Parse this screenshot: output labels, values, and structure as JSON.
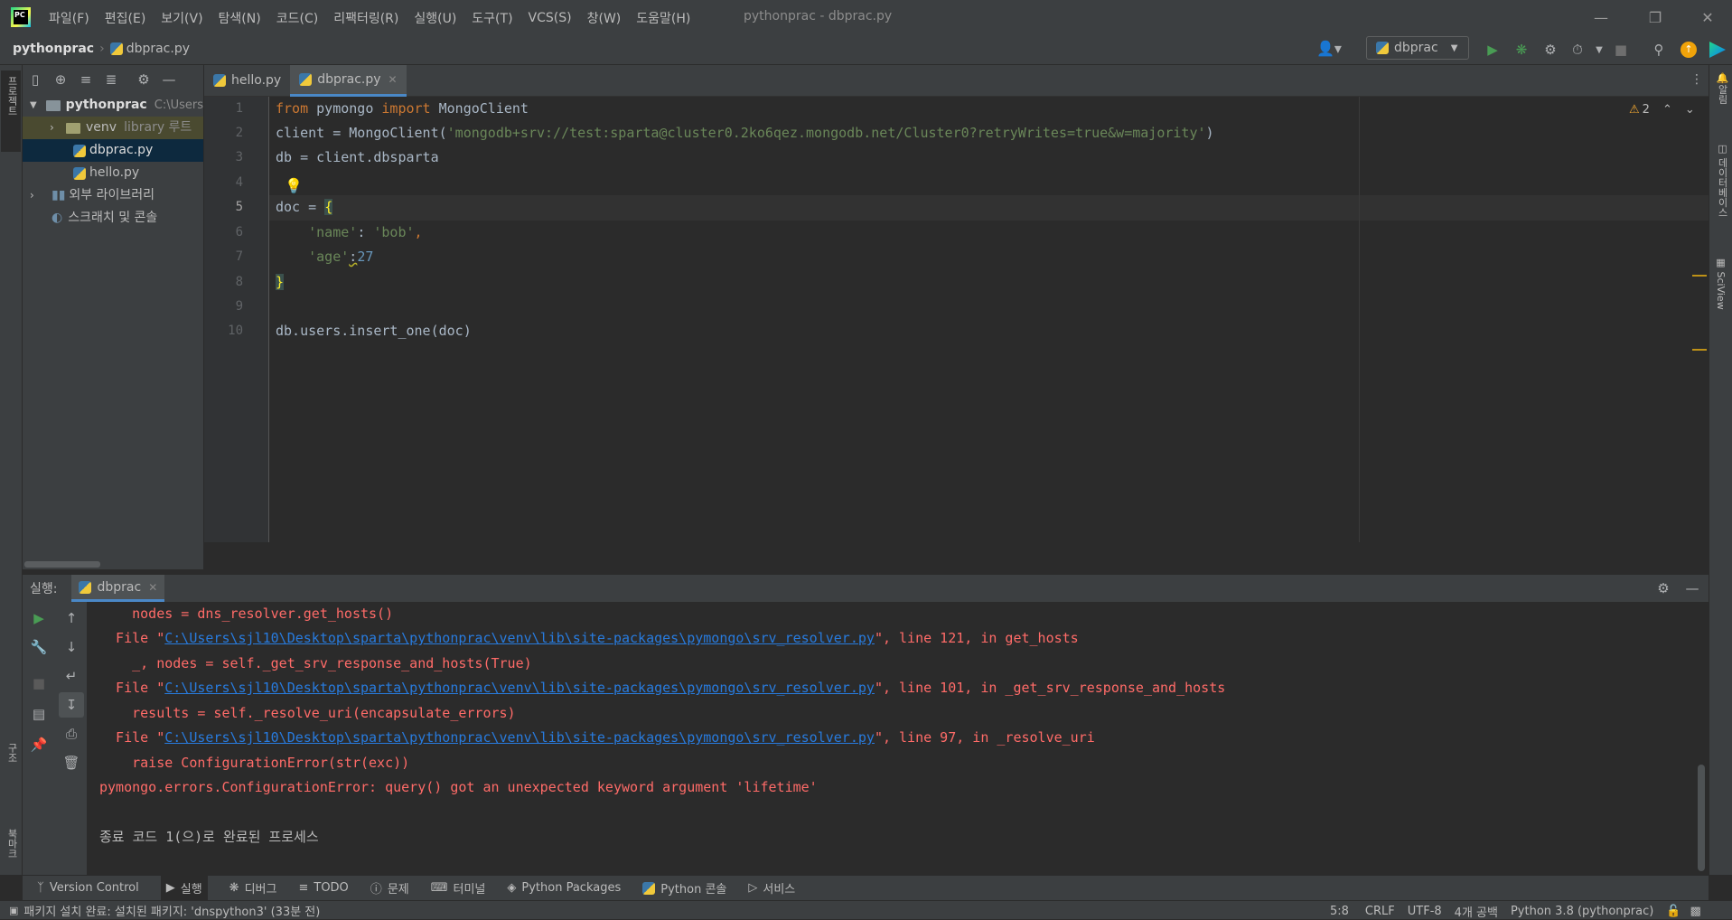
{
  "menu": [
    "파일(F)",
    "편집(E)",
    "보기(V)",
    "탐색(N)",
    "코드(C)",
    "리팩터링(R)",
    "실행(U)",
    "도구(T)",
    "VCS(S)",
    "창(W)",
    "도움말(H)"
  ],
  "window_title": "pythonprac - dbprac.py",
  "breadcrumb": {
    "project": "pythonprac",
    "file": "dbprac.py"
  },
  "run_config": "dbprac",
  "left_tool_label": "프로젝트",
  "left_tool_bottom1": "구조",
  "left_tool_bottom2": "북마크",
  "right_tool_labels": [
    "알림",
    "데이터베이스",
    "SciView"
  ],
  "project_tree": {
    "root": "pythonprac",
    "root_path": "C:\\Users",
    "venv": "venv",
    "venv_note": "library 루트",
    "file1": "dbprac.py",
    "file2": "hello.py",
    "ext_libs": "외부 라이브러리",
    "scratches": "스크래치 및 콘솔"
  },
  "tabs": [
    {
      "label": "hello.py"
    },
    {
      "label": "dbprac.py"
    }
  ],
  "warnings_count": "2",
  "line_numbers": [
    "1",
    "2",
    "3",
    "4",
    "5",
    "6",
    "7",
    "8",
    "9",
    "10"
  ],
  "code": {
    "l1_kw1": "from",
    "l1_mid": " pymongo ",
    "l1_kw2": "import",
    "l1_end": " MongoClient",
    "l2_a": "client = MongoClient(",
    "l2_str": "'mongodb+srv://test:sparta@cluster0.2ko6qez.mongodb.net/Cluster0?retryWrites=true&w=majority'",
    "l2_b": ")",
    "l3": "db = client.dbsparta",
    "l5_a": "doc = ",
    "l5_b": "{",
    "l6_str1": "'name'",
    "l6_mid": ": ",
    "l6_str2": "'bob'",
    "l6_end": ",",
    "l7_str": "'age'",
    "l7_mid": ":",
    "l7_num": "27",
    "l8": "}",
    "l10": "db.users.insert_one(doc)"
  },
  "run_panel": {
    "label": "실행:",
    "tab": "dbprac"
  },
  "console": {
    "c1": "    nodes = dns_resolver.get_hosts()",
    "c2_pre": "  File \"",
    "c2_link": "C:\\Users\\sjl10\\Desktop\\sparta\\pythonprac\\venv\\lib\\site-packages\\pymongo\\srv_resolver.py",
    "c2_post": "\", line 121, in get_hosts",
    "c3": "    _, nodes = self._get_srv_response_and_hosts(True)",
    "c4_pre": "  File \"",
    "c4_link": "C:\\Users\\sjl10\\Desktop\\sparta\\pythonprac\\venv\\lib\\site-packages\\pymongo\\srv_resolver.py",
    "c4_post": "\", line 101, in _get_srv_response_and_hosts",
    "c5": "    results = self._resolve_uri(encapsulate_errors)",
    "c6_pre": "  File \"",
    "c6_link": "C:\\Users\\sjl10\\Desktop\\sparta\\pythonprac\\venv\\lib\\site-packages\\pymongo\\srv_resolver.py",
    "c6_post": "\", line 97, in _resolve_uri",
    "c7": "    raise ConfigurationError(str(exc))",
    "c8": "pymongo.errors.ConfigurationError: query() got an unexpected keyword argument 'lifetime'",
    "c10": "종료 코드 1(으)로 완료된 프로세스"
  },
  "bottom_tabs": [
    "Version Control",
    "실행",
    "디버그",
    "TODO",
    "문제",
    "터미널",
    "Python Packages",
    "Python 콘솔",
    "서비스"
  ],
  "status": {
    "message": "패키지 설치 완료: 설치된 패키지: 'dnspython3' (33분 전)",
    "position": "5:8",
    "line_sep": "CRLF",
    "encoding": "UTF-8",
    "indent": "4개 공백",
    "interpreter": "Python 3.8 (pythonprac)"
  },
  "colors": {
    "bg": "#2b2b2b",
    "panel": "#3c3f41",
    "keyword": "#cc7832",
    "string": "#6a8759",
    "number": "#6897bb",
    "error": "#ff6b68",
    "link": "#287bde",
    "run_green": "#499c54"
  }
}
